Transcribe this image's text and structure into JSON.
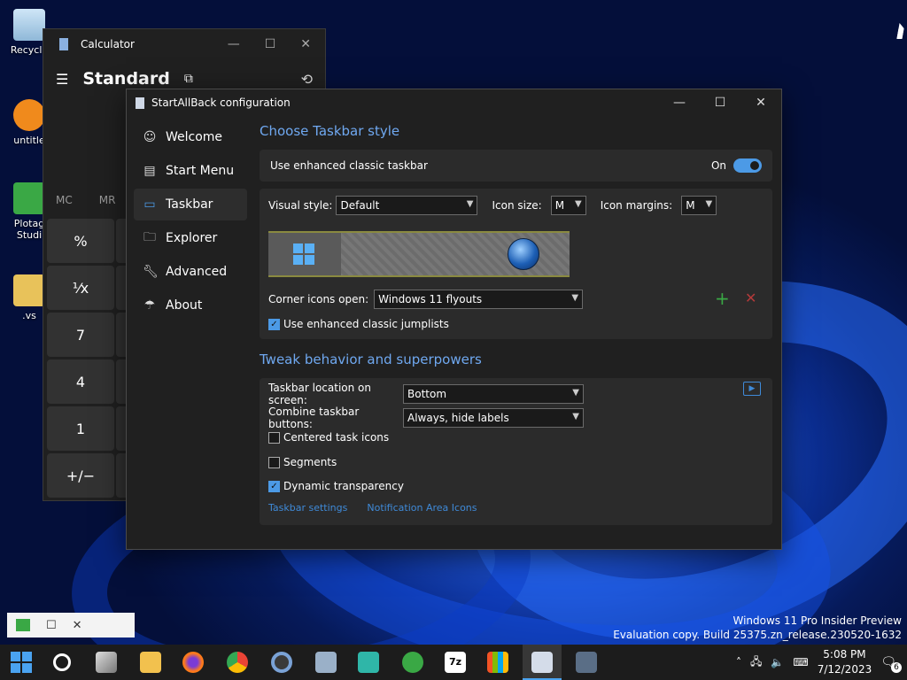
{
  "desktop": {
    "icons": [
      {
        "label": "Recycle"
      },
      {
        "label": "untitle"
      },
      {
        "label": "Plotag\nStudi"
      },
      {
        "label": ".vs"
      }
    ],
    "watermark_line1": "Windows 11 Pro Insider Preview",
    "watermark_line2": "Evaluation copy. Build 25375.zn_release.230520-1632"
  },
  "calculator": {
    "title": "Calculator",
    "mode": "Standard",
    "mem_buttons": [
      "MC",
      "MR"
    ],
    "buttons": [
      "%",
      "¹⁄x",
      "7",
      "4",
      "1",
      "+/−"
    ]
  },
  "sab": {
    "title": "StartAllBack configuration",
    "nav": [
      {
        "label": "Welcome",
        "icon": "smile-icon"
      },
      {
        "label": "Start Menu",
        "icon": "start-menu-icon"
      },
      {
        "label": "Taskbar",
        "icon": "taskbar-icon"
      },
      {
        "label": "Explorer",
        "icon": "folder-icon"
      },
      {
        "label": "Advanced",
        "icon": "wrench-icon"
      },
      {
        "label": "About",
        "icon": "about-icon"
      }
    ],
    "section1_title": "Choose Taskbar style",
    "enhanced_label": "Use enhanced classic taskbar",
    "enhanced_state": "On",
    "visual_style_label": "Visual style:",
    "visual_style_value": "Default",
    "icon_size_label": "Icon size:",
    "icon_size_value": "M",
    "icon_margins_label": "Icon margins:",
    "icon_margins_value": "M",
    "corner_icons_label": "Corner icons open:",
    "corner_icons_value": "Windows 11 flyouts",
    "jumplists_label": "Use enhanced classic jumplists",
    "section2_title": "Tweak behavior and superpowers",
    "location_label": "Taskbar location on screen:",
    "location_value": "Bottom",
    "combine_label": "Combine taskbar buttons:",
    "combine_value": "Always, hide labels",
    "centered_label": "Centered task icons",
    "segments_label": "Segments",
    "dynamic_label": "Dynamic transparency",
    "link_taskbar": "Taskbar settings",
    "link_notification": "Notification Area Icons"
  },
  "taskbar": {
    "time": "5:08 PM",
    "date": "7/12/2023",
    "notification_count": "6"
  },
  "colors": {
    "accent": "#4c9ae6",
    "section_title": "#6fa8f0",
    "link": "#3f8ad8"
  }
}
